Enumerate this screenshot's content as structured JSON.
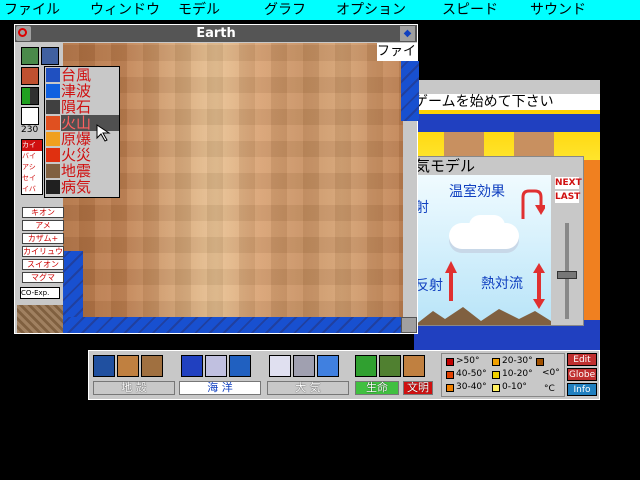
{
  "menubar": {
    "items": [
      "ファイル",
      "ウィンドウ",
      "モデル",
      "グラフ",
      "オプション",
      "スピード",
      "サウンド"
    ]
  },
  "earth_window": {
    "title": "Earth",
    "file_tab": "ファイ"
  },
  "toolbar": {
    "counter": "230",
    "tools": [
      "カイ",
      "バイ",
      "アシ",
      "セイ",
      "イバ"
    ],
    "buttons": [
      "キオン",
      "アメ",
      "カザム+",
      "カイリュウ",
      "スイオン",
      "マグマ"
    ],
    "mode_label": "CO-Exp."
  },
  "disaster_menu": {
    "items": [
      "台風",
      "津波",
      "隕石",
      "火山",
      "原爆",
      "火災",
      "地震",
      "病気"
    ],
    "selected": "火山"
  },
  "game_window": {
    "message": "ゲームを始めて下さい"
  },
  "atmosphere_model": {
    "title": "気モデル",
    "greenhouse": "温室効果",
    "reflect": "反射",
    "convection": "熱対流",
    "partial": "射",
    "next": "NEXT",
    "last": "LAST"
  },
  "bottom_panel": {
    "categories": [
      "地 殻",
      "海 洋",
      "大 気",
      "生命",
      "文明"
    ],
    "legend": [
      {
        "label": ">50°",
        "color": "#c00000"
      },
      {
        "label": "40-50°",
        "color": "#e04000"
      },
      {
        "label": "30-40°",
        "color": "#f08000"
      },
      {
        "label": "20-30°",
        "color": "#f0a000"
      },
      {
        "label": "10-20°",
        "color": "#f0d000"
      },
      {
        "label": "0-10°",
        "color": "#fff060"
      },
      {
        "label": "<0°",
        "color": "#a05000"
      }
    ],
    "unit": "°C",
    "buttons": [
      "Edit",
      "Globe",
      "Info"
    ]
  }
}
